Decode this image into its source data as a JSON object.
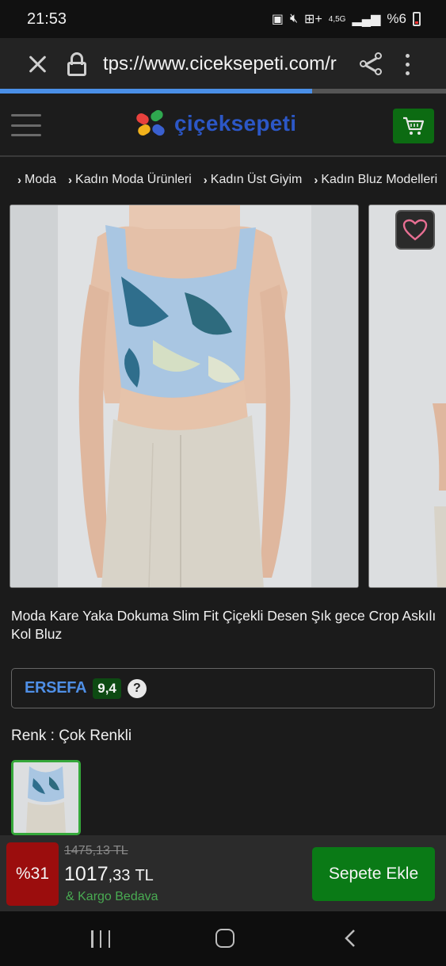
{
  "status_bar": {
    "time": "21:53",
    "network": "4,5G",
    "battery": "%6"
  },
  "browser": {
    "url": "tps://www.ciceksepeti.com/r",
    "load_progress": 0.7
  },
  "site": {
    "logo_text": "çiçeksepeti",
    "brand_colors": {
      "accent_green": "#0a7a16",
      "logo_blue": "#2c57c6"
    }
  },
  "breadcrumb": [
    "Moda",
    "Kadın Moda Ürünleri",
    "Kadın Üst Giyim",
    "Kadın Bluz Modelleri"
  ],
  "product": {
    "title": "Moda Kare Yaka Dokuma Slim Fit Çiçekli Desen Şık gece Crop Askılı Kol Bluz",
    "seller": {
      "name": "ERSEFA",
      "score": "9,4",
      "help": "?"
    },
    "color_label": "Renk : Çok Renkli"
  },
  "price_bar": {
    "discount": "%31",
    "old_price": "1475,13 TL",
    "price_int": "1017",
    "price_dec": ",33",
    "currency": "TL",
    "shipping": "& Kargo Bedava",
    "add_to_cart": "Sepete Ekle"
  }
}
